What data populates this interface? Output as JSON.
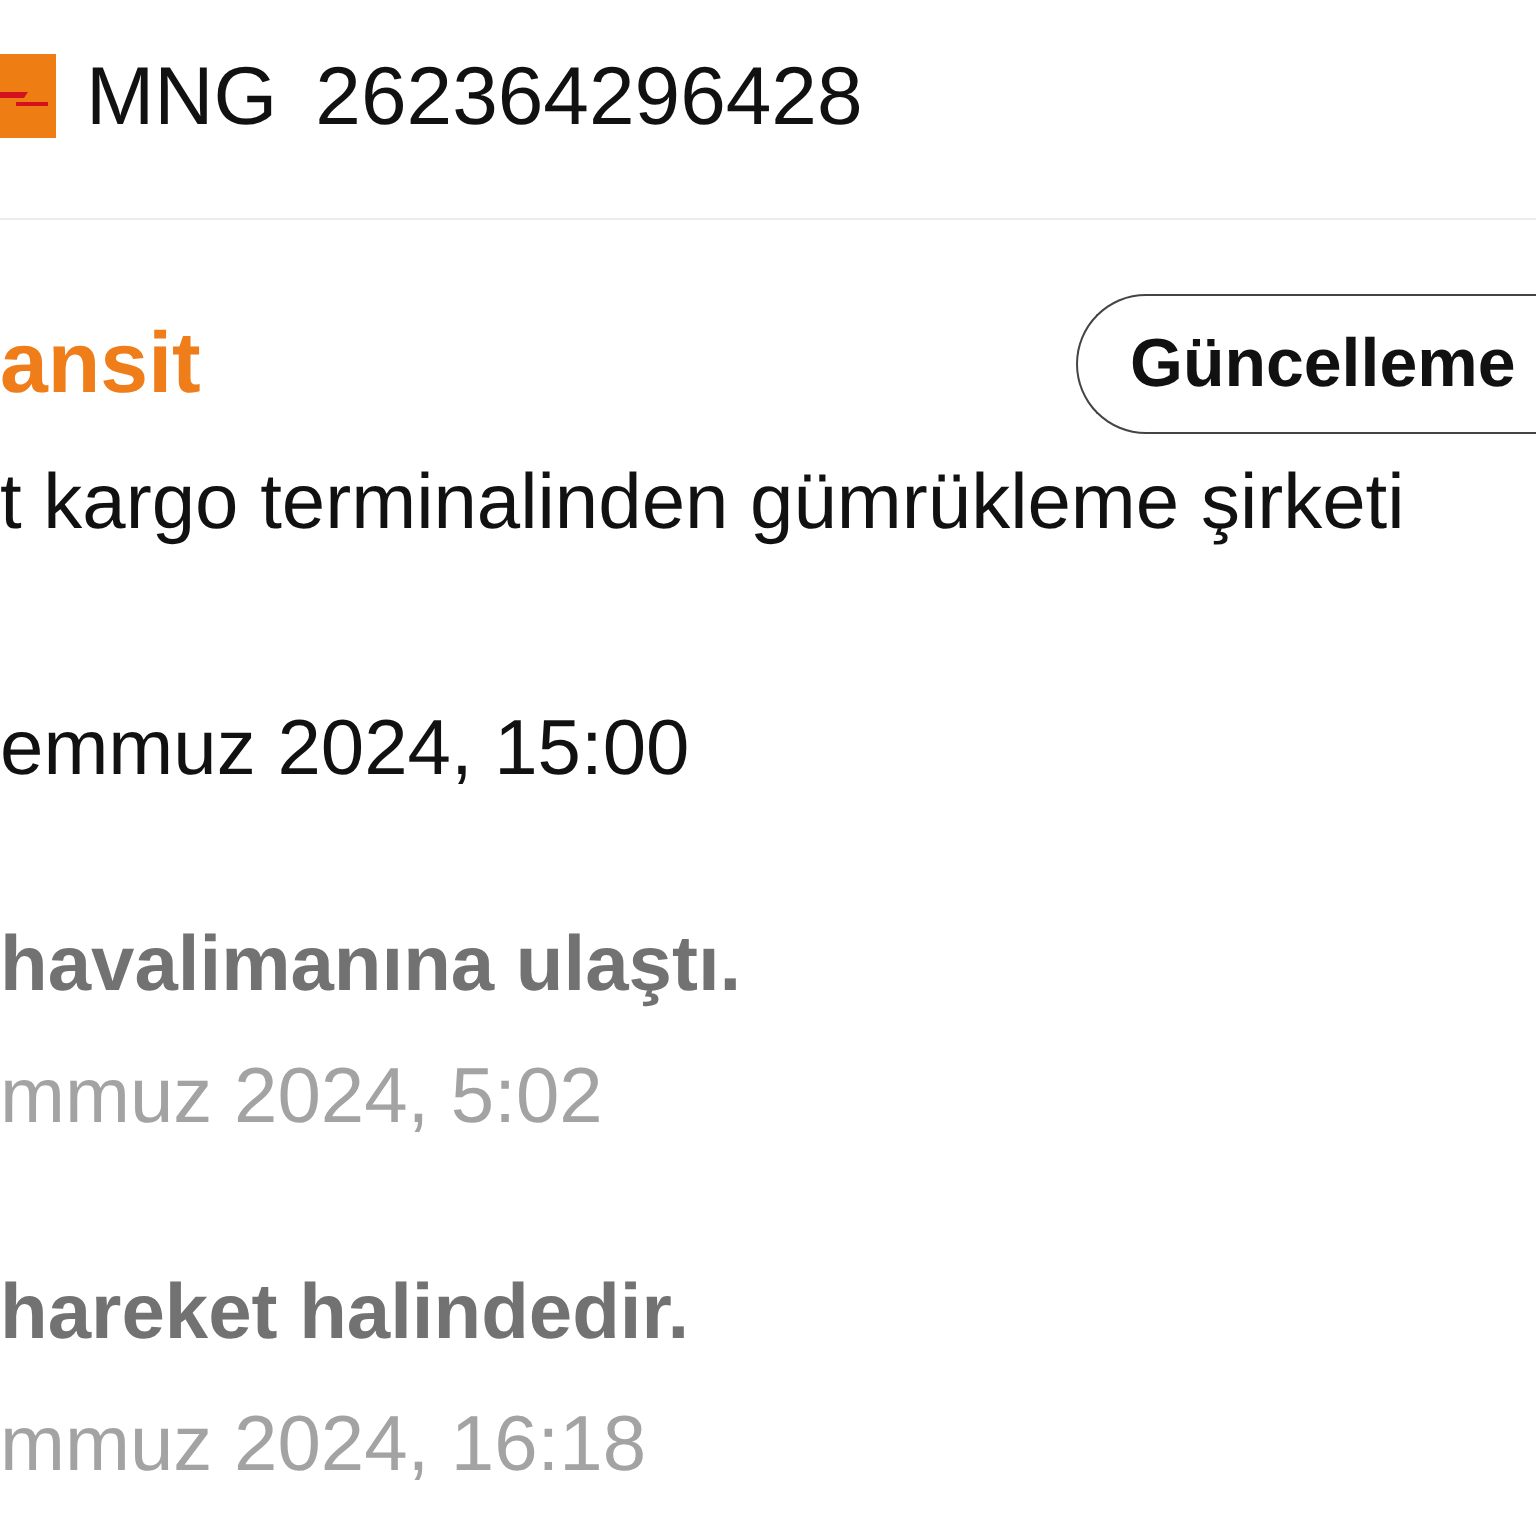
{
  "header": {
    "carrier": "MNG",
    "tracking_number": "262364296428"
  },
  "status": {
    "title": "ansit",
    "update_button": "Güncelleme"
  },
  "events": [
    {
      "description": "t kargo terminalinden gümrükleme şirketi",
      "date": "emmuz 2024, 15:00",
      "active": true
    },
    {
      "description": "havalimanına ulaştı.",
      "date": "mmuz 2024, 5:02",
      "active": false
    },
    {
      "description": "hareket halindedir.",
      "date": "mmuz 2024, 16:18",
      "active": false
    }
  ]
}
